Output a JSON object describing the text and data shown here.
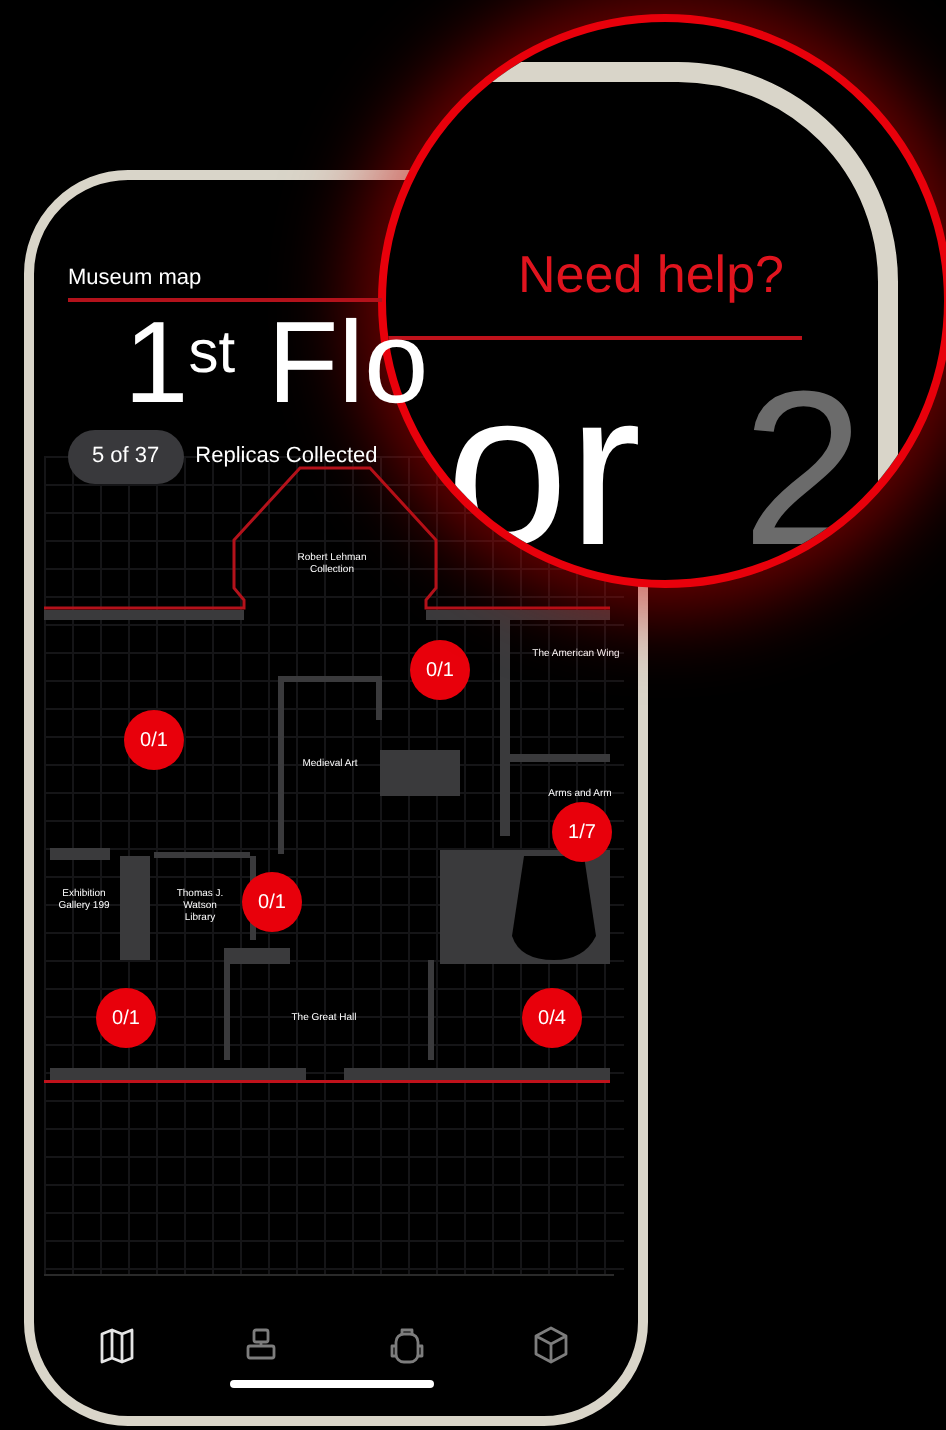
{
  "phone": {
    "header": {
      "title": "Museum map",
      "floor_title": "1$^{st}$ Flo"
    },
    "progress": {
      "count": "5 of 37",
      "label": "Replicas Collected"
    },
    "map": {
      "rooms": [
        {
          "label": "Robert Lehman Collection"
        },
        {
          "label": "The American Wing"
        },
        {
          "label": "Medieval Art"
        },
        {
          "label": "Arms and Arm"
        },
        {
          "label": "Exhibition Gallery 199"
        },
        {
          "label": "Thomas J. Watson Library"
        },
        {
          "label": "The Great Hall"
        }
      ],
      "markers": [
        {
          "count": "0/1"
        },
        {
          "count": "0/1"
        },
        {
          "count": "1/7"
        },
        {
          "count": "0/1"
        },
        {
          "count": "0/1"
        },
        {
          "count": "0/4"
        }
      ]
    },
    "tab_bar": {
      "tabs": [
        {
          "kind": "map",
          "selected": true
        },
        {
          "kind": "stamp",
          "selected": false
        },
        {
          "kind": "backpack",
          "selected": false
        },
        {
          "kind": "cube",
          "selected": false
        }
      ]
    }
  },
  "magnifier": {
    "help_link": "Need help?",
    "floor_title": "or",
    "next_floor": "2"
  }
}
